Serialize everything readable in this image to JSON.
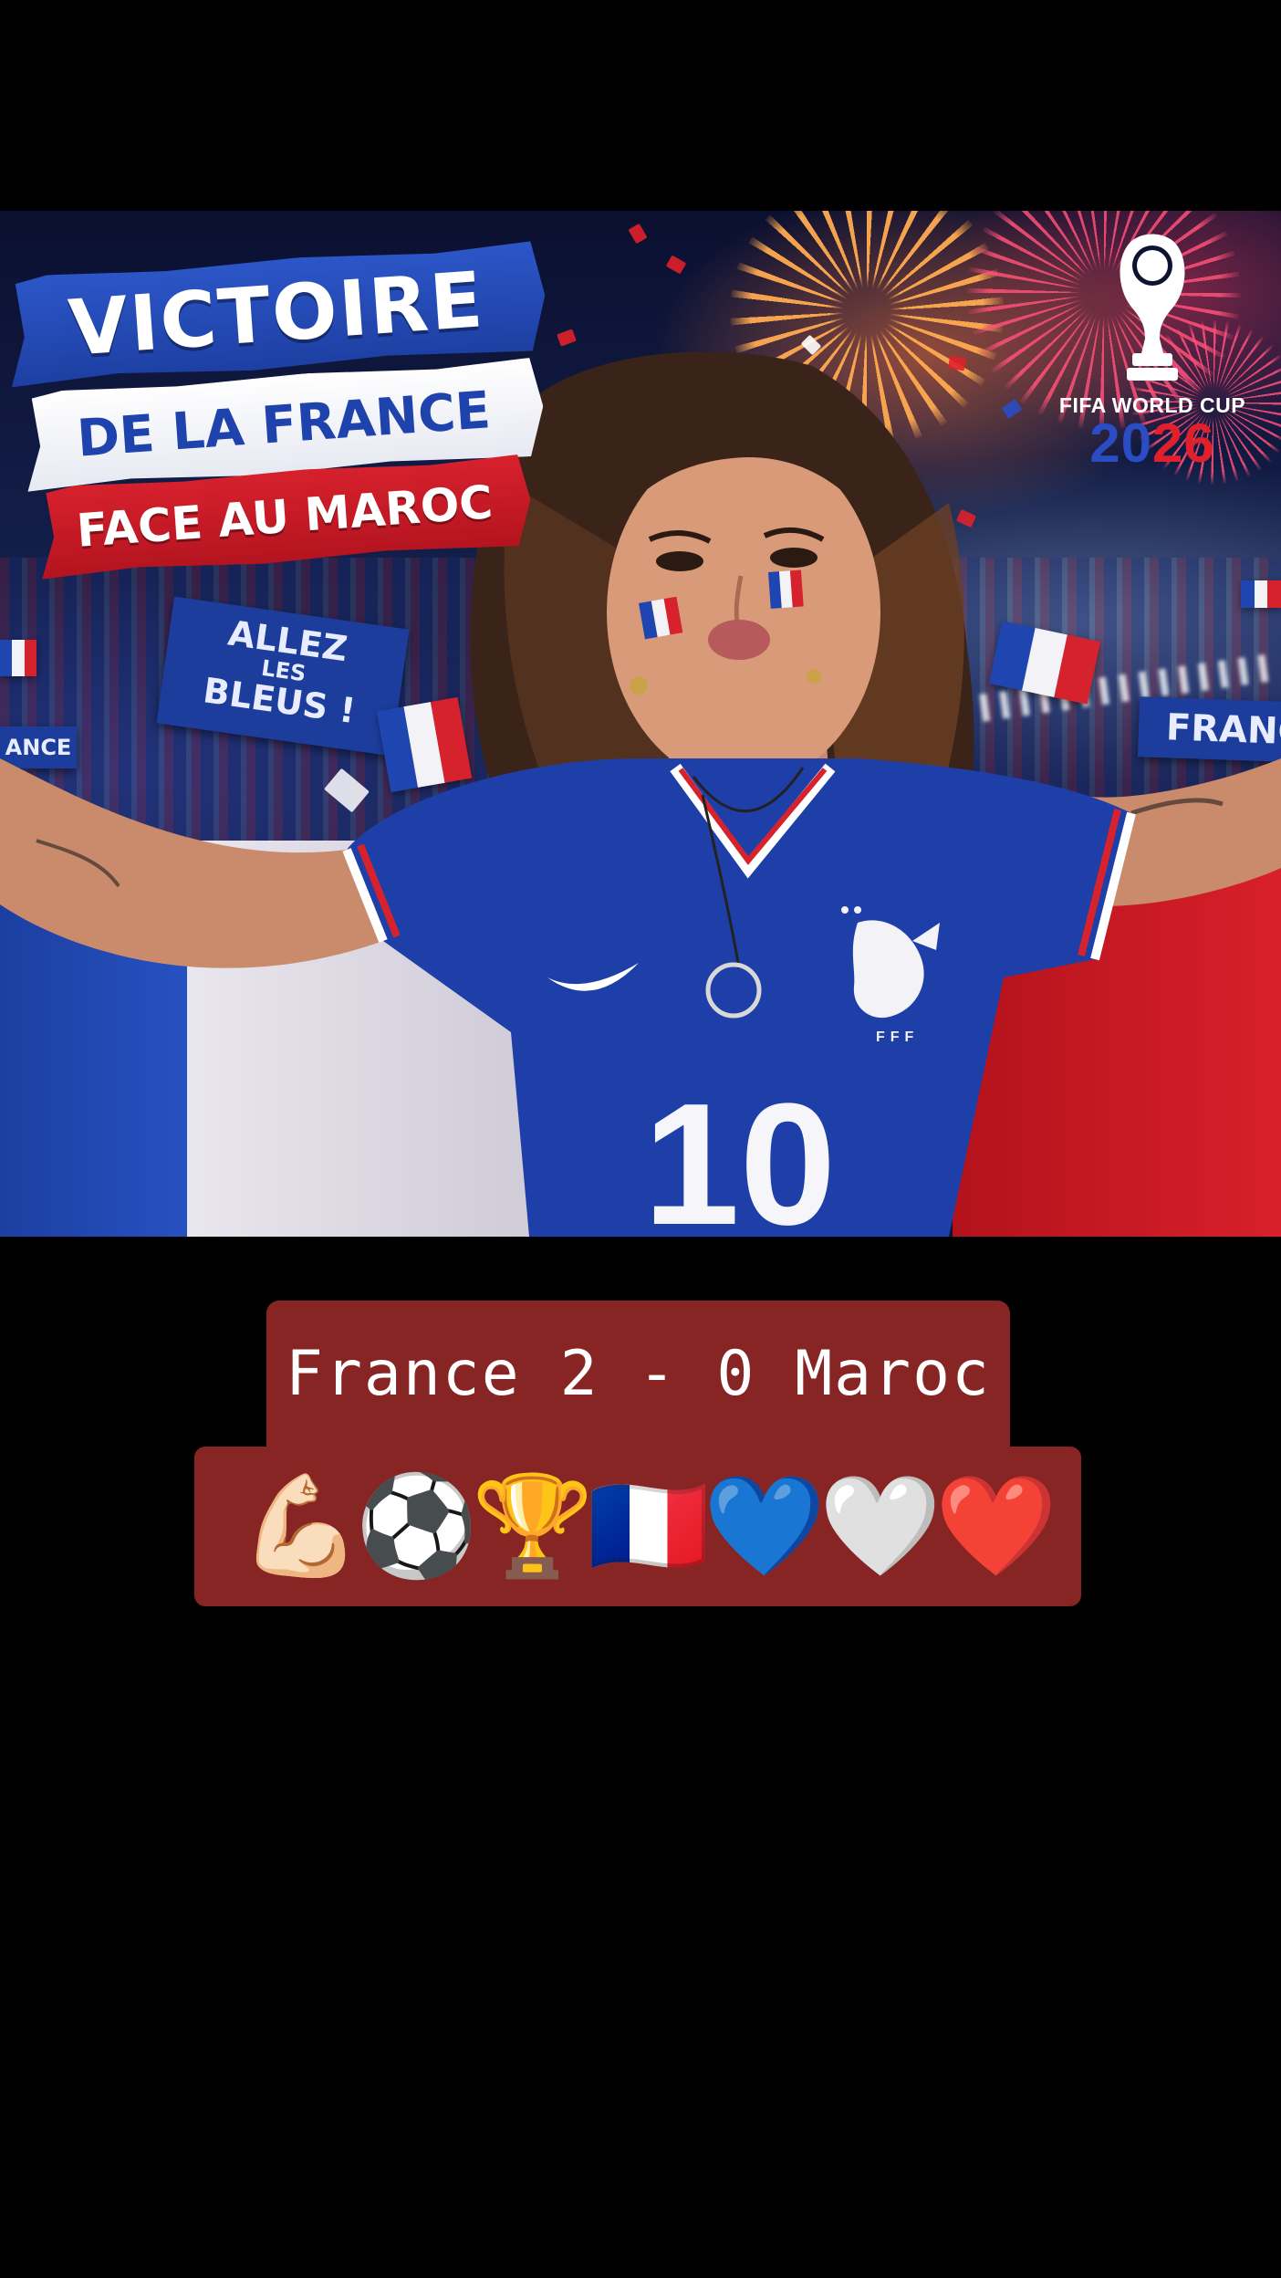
{
  "hero": {
    "title": {
      "line1": "VICTOIRE",
      "line2": "DE LA FRANCE",
      "line3": "FACE AU MAROC"
    },
    "logo": {
      "line1": "FIFA WORLD CUP",
      "year_a": "20",
      "year_b": "26"
    },
    "banners": {
      "allez_line1": "ALLEZ",
      "allez_line2": "LES",
      "allez_line3": "BLEUS !",
      "right": "FRANC",
      "left": "ANCE"
    },
    "jersey": {
      "number": "10",
      "crest": "FFF"
    }
  },
  "score": {
    "text": "France 2 - 0 Maroc"
  },
  "emojis": [
    "💪🏻",
    "⚽",
    "🏆",
    "🇫🇷",
    "💙",
    "🤍",
    "❤️"
  ],
  "colors": {
    "background": "#000000",
    "card": "#862523",
    "france_blue": "#1f45b0",
    "france_red": "#d6222c"
  }
}
